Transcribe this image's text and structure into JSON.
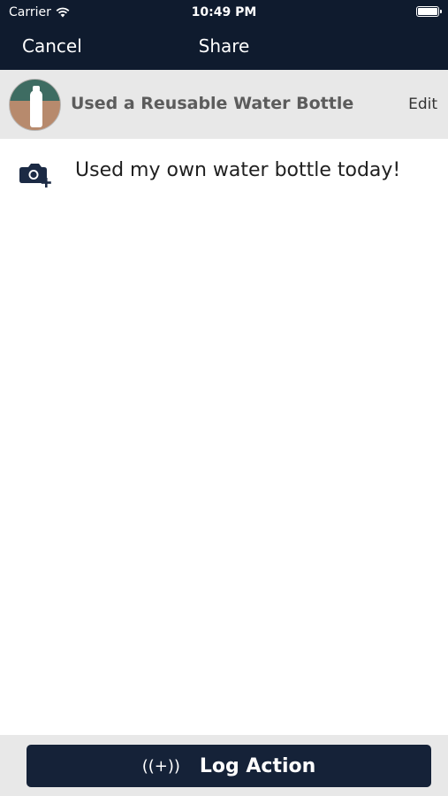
{
  "status_bar": {
    "carrier": "Carrier",
    "time": "10:49 PM"
  },
  "nav": {
    "cancel_label": "Cancel",
    "title": "Share"
  },
  "action": {
    "title": "Used a Reusable Water Bottle",
    "edit_label": "Edit"
  },
  "post": {
    "text": "Used my own water bottle today!"
  },
  "footer": {
    "log_icon": "((+))",
    "log_label": "Log Action"
  },
  "colors": {
    "nav_bg": "#0f1b2e",
    "button_bg": "#152238",
    "row_bg": "#e8e8e8"
  }
}
